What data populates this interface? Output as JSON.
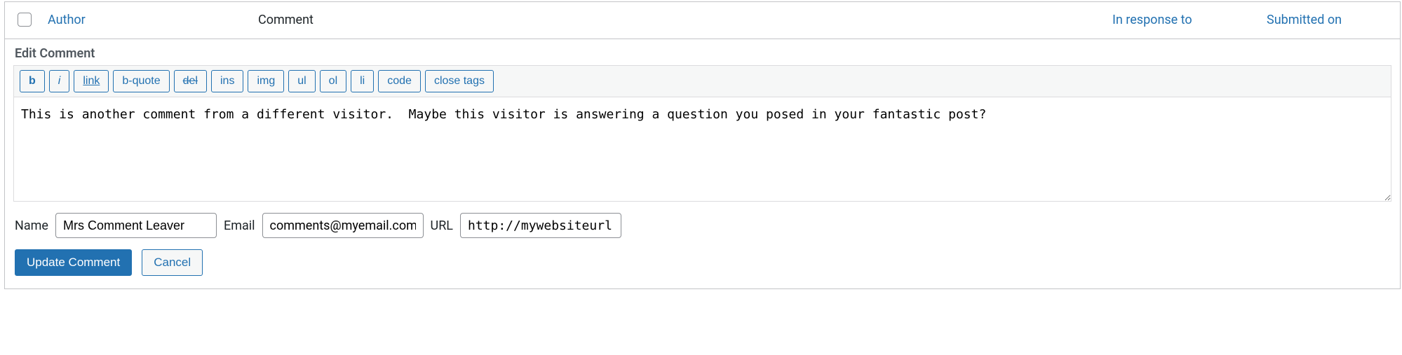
{
  "columns": {
    "author": "Author",
    "comment": "Comment",
    "response": "In response to",
    "submitted": "Submitted on"
  },
  "editor": {
    "title": "Edit Comment",
    "toolbar": {
      "b": "b",
      "i": "i",
      "link": "link",
      "bquote": "b-quote",
      "del": "del",
      "ins": "ins",
      "img": "img",
      "ul": "ul",
      "ol": "ol",
      "li": "li",
      "code": "code",
      "close": "close tags"
    },
    "content": "This is another comment from a different visitor.  Maybe this visitor is answering a question you posed in your fantastic post?"
  },
  "fields": {
    "name_label": "Name",
    "name_value": "Mrs Comment Leaver",
    "email_label": "Email",
    "email_value": "comments@myemail.com",
    "url_label": "URL",
    "url_value": "http://mywebsiteurl"
  },
  "actions": {
    "update": "Update Comment",
    "cancel": "Cancel"
  }
}
